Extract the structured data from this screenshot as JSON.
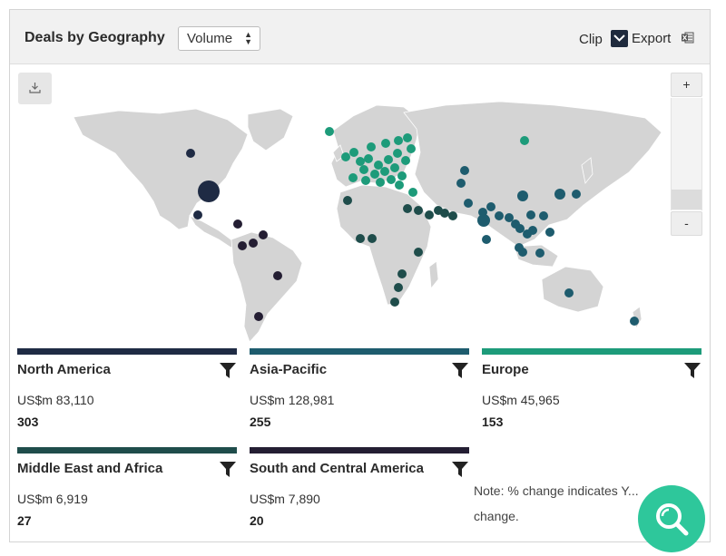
{
  "header": {
    "title": "Deals by Geography",
    "metric_select": "Volume",
    "clip_label": "Clip",
    "export_label": "Export"
  },
  "map": {
    "zoom_in_label": "+",
    "zoom_out_label": "-"
  },
  "colors": {
    "north_america": "#1f2b44",
    "asia_pacific": "#1e5c6e",
    "europe": "#1d9b7a",
    "middle_east_africa": "#1f4d4b",
    "south_central_america": "#241e33",
    "land": "#d4d4d4",
    "fab": "#2ec79b"
  },
  "regions": [
    {
      "name": "North America",
      "value": "US$m 83,110",
      "count": "303"
    },
    {
      "name": "Asia-Pacific",
      "value": "US$m 128,981",
      "count": "255"
    },
    {
      "name": "Europe",
      "value": "US$m 45,965",
      "count": "153"
    },
    {
      "name": "Middle East and Africa",
      "value": "US$m 6,919",
      "count": "27"
    },
    {
      "name": "South and Central America",
      "value": "US$m 7,890",
      "count": "20"
    }
  ],
  "note": "Note: % change indicates Y... change."
}
